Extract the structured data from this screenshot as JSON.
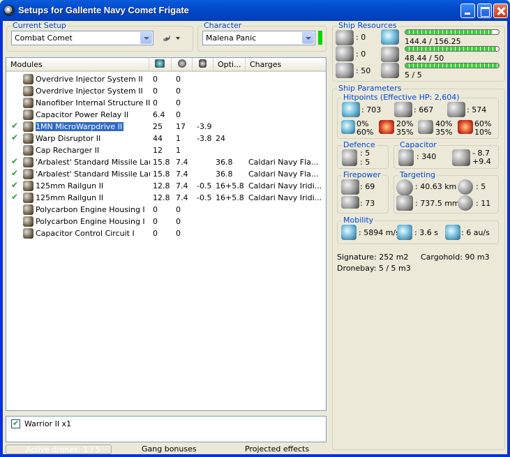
{
  "window": {
    "title": "Setups for Gallente Navy Comet Frigate"
  },
  "current_setup": {
    "label": "Current Setup",
    "value": "Combat Comet"
  },
  "character": {
    "label": "Character",
    "value": "Malena Panic"
  },
  "modules": {
    "header": {
      "name": "Modules",
      "opt": "Opti...",
      "charges": "Charges"
    },
    "rows": [
      {
        "name": "Overdrive Injector System II",
        "c1": "0",
        "c2": "0",
        "c3": "",
        "c4": "",
        "charge": "",
        "active": false,
        "selected": false
      },
      {
        "name": "Overdrive Injector System II",
        "c1": "0",
        "c2": "0",
        "c3": "",
        "c4": "",
        "charge": "",
        "active": false,
        "selected": false
      },
      {
        "name": "Nanofiber Internal Structure II",
        "c1": "0",
        "c2": "0",
        "c3": "",
        "c4": "",
        "charge": "",
        "active": false,
        "selected": false
      },
      {
        "name": "Capacitor Power Relay II",
        "c1": "6.4",
        "c2": "0",
        "c3": "",
        "c4": "",
        "charge": "",
        "active": false,
        "selected": false
      },
      {
        "name": "1MN MicroWarpdrive II",
        "c1": "25",
        "c2": "17",
        "c3": "-3.9",
        "c4": "",
        "charge": "",
        "active": true,
        "selected": true
      },
      {
        "name": "Warp Disruptor II",
        "c1": "44",
        "c2": "1",
        "c3": "-3.8",
        "c4": "24",
        "charge": "",
        "active": true,
        "selected": false
      },
      {
        "name": "Cap Recharger II",
        "c1": "12",
        "c2": "1",
        "c3": "",
        "c4": "",
        "charge": "",
        "active": false,
        "selected": false
      },
      {
        "name": "'Arbalest' Standard Missile Laun...",
        "c1": "15.8",
        "c2": "7.4",
        "c3": "",
        "c4": "36.8",
        "charge": "Caldari Navy Fla...",
        "active": true,
        "selected": false
      },
      {
        "name": "'Arbalest' Standard Missile Laun...",
        "c1": "15.8",
        "c2": "7.4",
        "c3": "",
        "c4": "36.8",
        "charge": "Caldari Navy Fla...",
        "active": true,
        "selected": false
      },
      {
        "name": "125mm Railgun II",
        "c1": "12.8",
        "c2": "7.4",
        "c3": "-0.5",
        "c4": "16+5.8",
        "charge": "Caldari Navy Iridi...",
        "active": true,
        "selected": false
      },
      {
        "name": "125mm Railgun II",
        "c1": "12.8",
        "c2": "7.4",
        "c3": "-0.5",
        "c4": "16+5.8",
        "charge": "Caldari Navy Iridi...",
        "active": true,
        "selected": false
      },
      {
        "name": "Polycarbon Engine Housing I",
        "c1": "0",
        "c2": "0",
        "c3": "",
        "c4": "",
        "charge": "",
        "active": false,
        "selected": false
      },
      {
        "name": "Polycarbon Engine Housing I",
        "c1": "0",
        "c2": "0",
        "c3": "",
        "c4": "",
        "charge": "",
        "active": false,
        "selected": false
      },
      {
        "name": "Capacitor Control Circuit I",
        "c1": "0",
        "c2": "0",
        "c3": "",
        "c4": "",
        "charge": "",
        "active": false,
        "selected": false
      }
    ]
  },
  "drones": {
    "items": [
      {
        "label": "Warrior II x1",
        "checked": true
      }
    ]
  },
  "status": {
    "active_drones": "Active drones: 1 / 5",
    "gang": "Gang bonuses",
    "projected": "Projected effects"
  },
  "resources": {
    "title": "Ship Resources",
    "hardpoints": [
      "0",
      "0",
      "50"
    ],
    "cpu": {
      "text": "144.4 / 156.25",
      "fraction": 0.924
    },
    "power": {
      "text": "48.44 / 50",
      "fraction": 0.969
    },
    "drone_bw": {
      "text": "5 / 5",
      "fraction": 1.0
    }
  },
  "parameters": {
    "title": "Ship Parameters",
    "hitpoints": {
      "title": "Hitpoints (Effective HP: 2,604)",
      "shield": ": 703",
      "armor": ": 667",
      "structure": ": 574",
      "em": [
        "0%",
        "60%"
      ],
      "thermal": [
        "20%",
        "35%"
      ],
      "kinetic": [
        "40%",
        "35%"
      ],
      "explosive": [
        "60%",
        "10%"
      ]
    },
    "defence": {
      "title": "Defence",
      "values": [
        ": 5",
        ": 5"
      ]
    },
    "capacitor": {
      "title": "Capacitor",
      "capacity": ": 340",
      "delta": [
        "- 8.7",
        "+9.4"
      ]
    },
    "firepower": {
      "title": "Firepower",
      "turret": ": 69",
      "missile": ": 73"
    },
    "targeting": {
      "title": "Targeting",
      "range": ": 40.63 km",
      "targets": ": 5",
      "resolution": ": 737.5 mm",
      "sensor": ": 11"
    },
    "mobility": {
      "title": "Mobility",
      "velocity": ": 5894 m/s",
      "align": ": 3.6 s",
      "warp": ": 6 au/s"
    },
    "signature": "Signature: 252 m2",
    "cargohold": "Cargohold: 90 m3",
    "dronebay": "Dronebay: 5 / 5 m3"
  }
}
